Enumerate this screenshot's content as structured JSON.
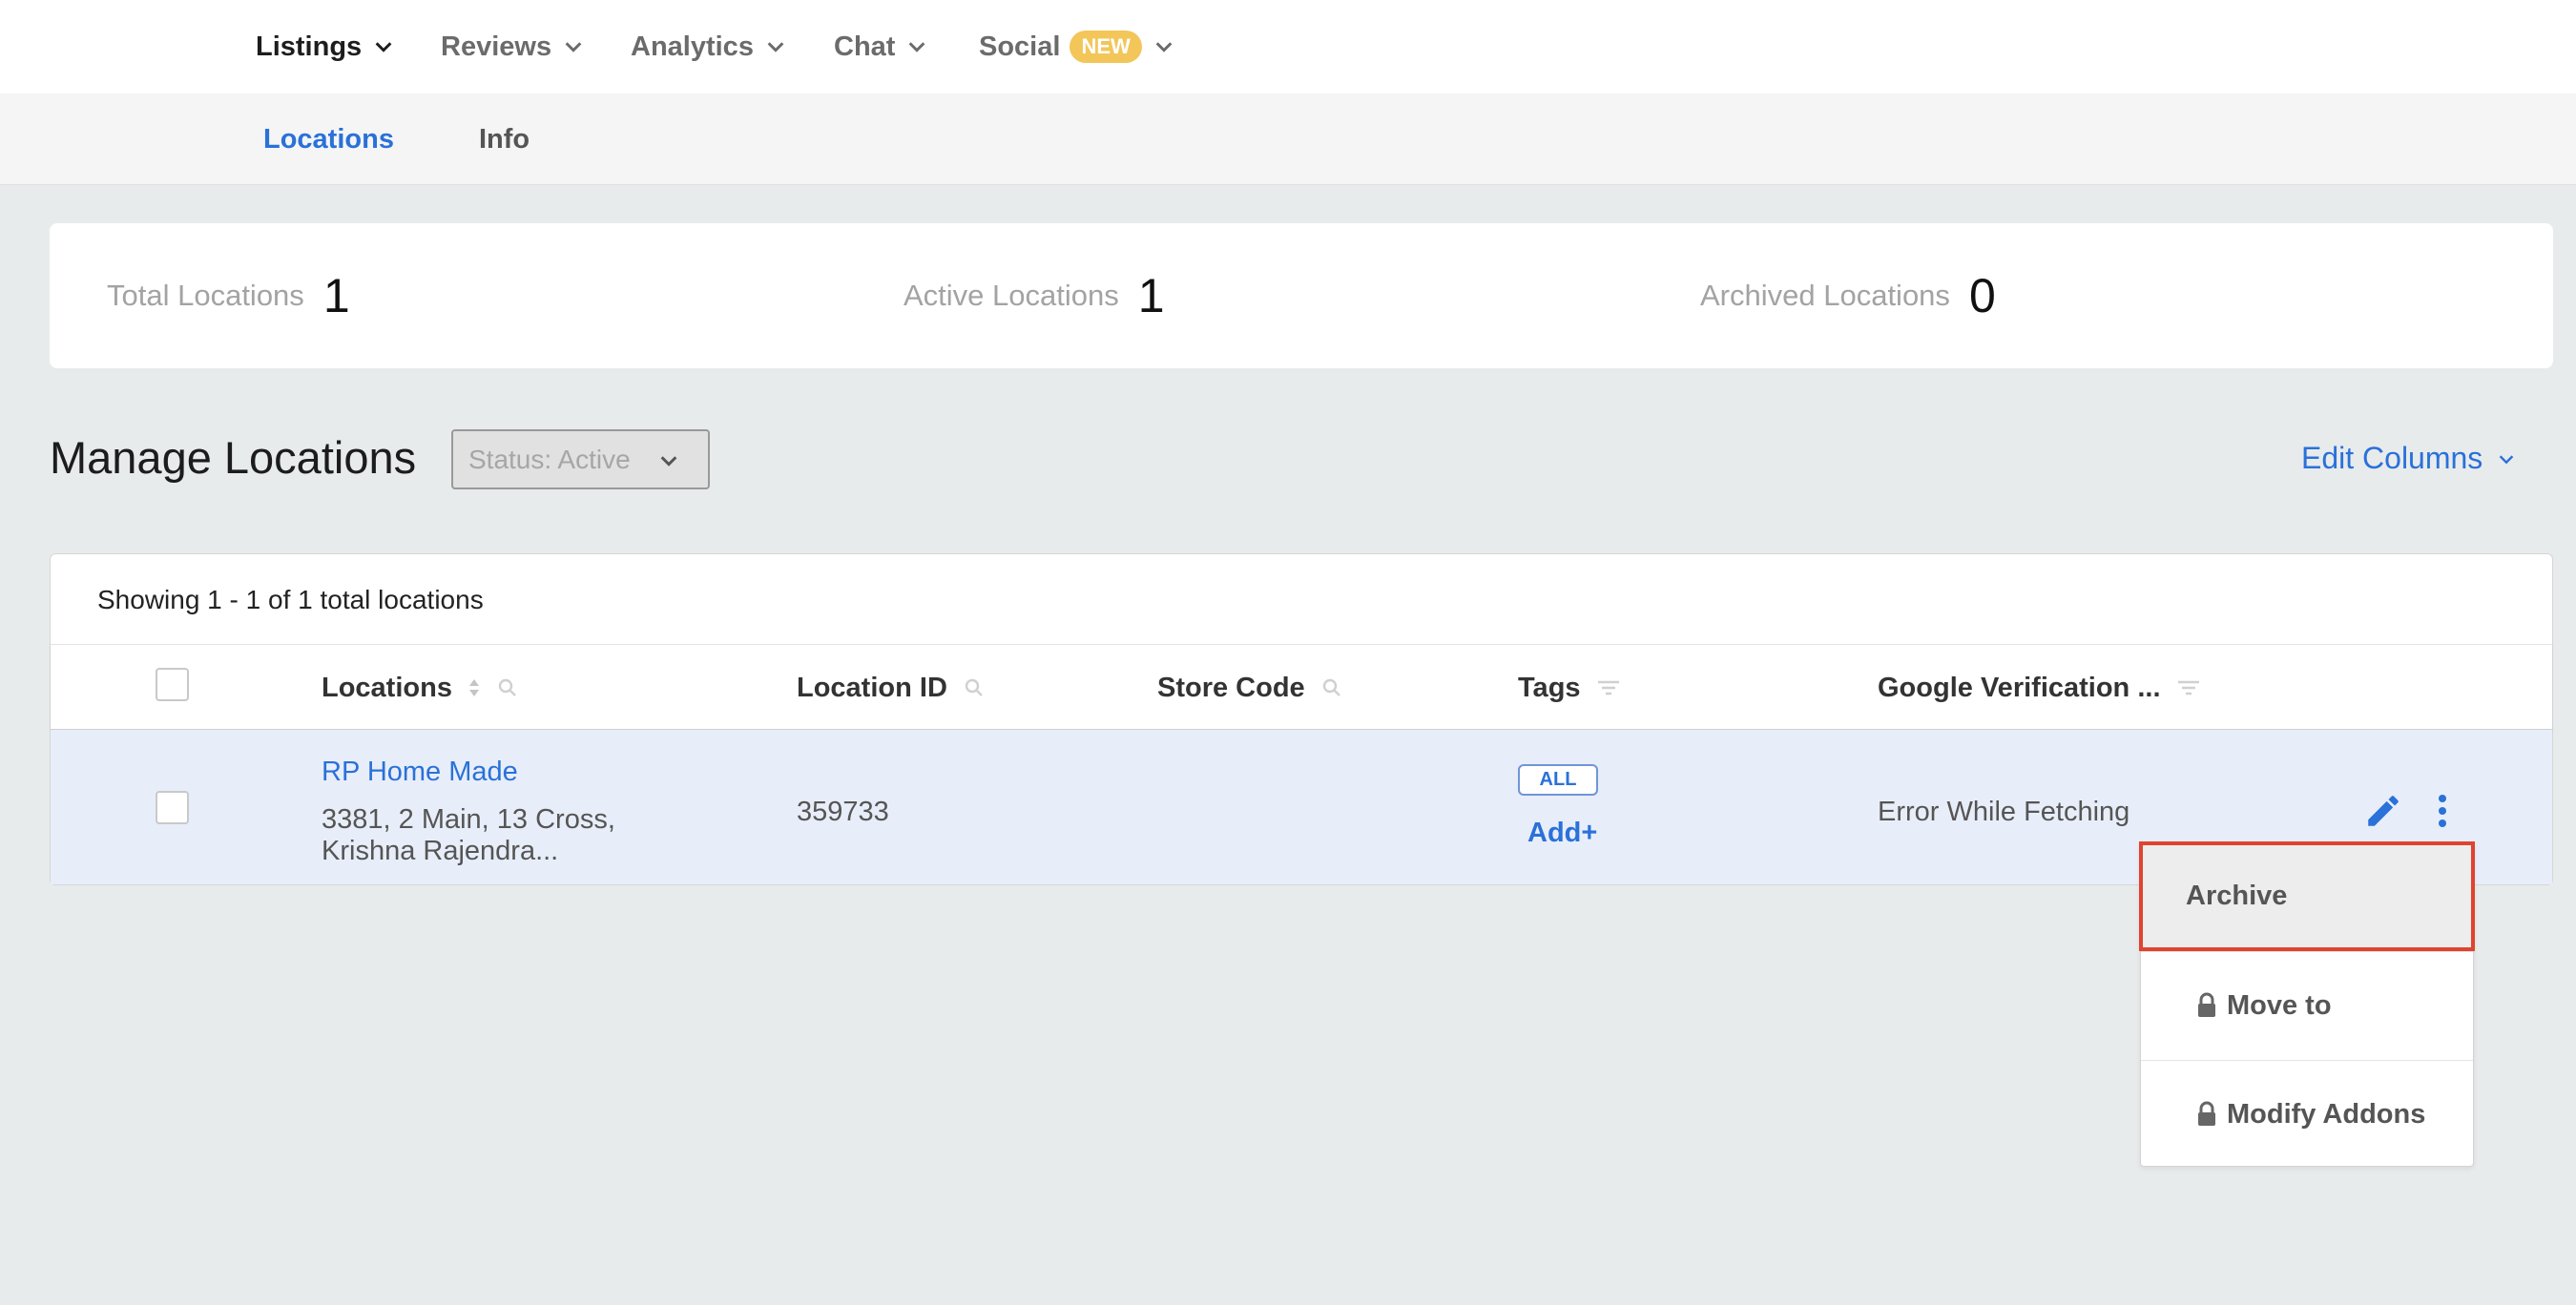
{
  "topnav": {
    "items": [
      {
        "label": "Listings",
        "active": true
      },
      {
        "label": "Reviews"
      },
      {
        "label": "Analytics"
      },
      {
        "label": "Chat"
      },
      {
        "label": "Social",
        "badge": "NEW"
      }
    ]
  },
  "subnav": {
    "tabs": [
      {
        "label": "Locations",
        "active": true
      },
      {
        "label": "Info"
      }
    ]
  },
  "stats": [
    {
      "label": "Total Locations",
      "value": "1"
    },
    {
      "label": "Active Locations",
      "value": "1"
    },
    {
      "label": "Archived Locations",
      "value": "0"
    }
  ],
  "manage": {
    "title": "Manage Locations",
    "status_select": "Status: Active",
    "edit_columns": "Edit Columns"
  },
  "table": {
    "showing": "Showing 1 - 1 of 1 total locations",
    "columns": [
      "Locations",
      "Location ID",
      "Store Code",
      "Tags",
      "Google Verification ..."
    ],
    "rows": [
      {
        "name": "RP Home Made",
        "address": "3381, 2 Main, 13 Cross, Krishna Rajendra...",
        "location_id": "359733",
        "store_code": "",
        "tag": "ALL",
        "add_tag": "Add+",
        "google_verification": "Error While Fetching"
      }
    ]
  },
  "menu": {
    "items": [
      "Archive",
      "Move to",
      "Modify Addons"
    ]
  },
  "colors": {
    "accent": "#2a71d9",
    "badge": "#f3c65a",
    "highlight_border": "#e0432f",
    "row_selected": "#e8eef9"
  }
}
